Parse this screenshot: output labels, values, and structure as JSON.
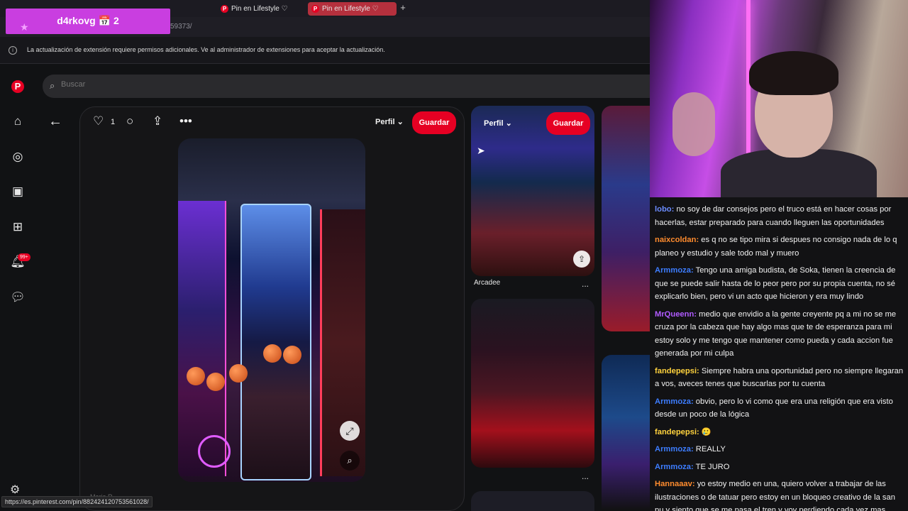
{
  "browser": {
    "tabs": [
      {
        "label": "Pin en Lifestyle ♡",
        "active": false
      },
      {
        "label": "Pin en Lifestyle ♡",
        "active": true
      }
    ],
    "new_tab": "+",
    "url_fragment": "59373/"
  },
  "overlay": {
    "badge_text": "d4rkovg 📅 2"
  },
  "notification": {
    "text": "La actualización de extensión requiere permisos adicionales. Ve al administrador de extensiones para aceptar la actualización."
  },
  "search": {
    "placeholder": "Buscar"
  },
  "nav": {
    "notifications_count": "99+"
  },
  "pin": {
    "like_count": "1",
    "profile_label": "Perfil",
    "save_label": "Guardar",
    "author": "Mario R."
  },
  "related": {
    "card1": {
      "profile_label": "Perfil",
      "save_label": "Guardar",
      "title": "Arcadee"
    },
    "more": "..."
  },
  "status_url": "https://es.pinterest.com/pin/882424120753561028/",
  "chat": [
    {
      "user": "lobo:",
      "color": "#6b8cff",
      "text": "no soy de dar consejos pero el truco está en hacer cosas por hacerlas, estar preparado para cuando lleguen las oportunidades"
    },
    {
      "user": "naixcoldan:",
      "color": "#ff8c2e",
      "text": "es q no se tipo mira si despues no consigo nada de lo q planeo y estudio y sale todo mal y muero"
    },
    {
      "user": "Armmoza:",
      "color": "#3d7dff",
      "text": "Tengo una amiga budista, de Soka, tienen la creencia de que se puede salir hasta de lo peor pero por su propia cuenta, no sé explicarlo bien, pero vi un acto que hicieron y era muy lindo"
    },
    {
      "user": "MrQueenn:",
      "color": "#b05bff",
      "text": "medio que envidio a la gente creyente pq a mi no se me cruza por la cabeza que hay algo mas que te de esperanza para mi estoy solo y me tengo que mantener como pueda y cada accion fue generada por mi culpa"
    },
    {
      "user": "fandepepsi:",
      "color": "#ffd23d",
      "text": "Siempre habra una oportunidad pero no siempre llegaran a vos, aveces tenes que buscarlas por tu cuenta"
    },
    {
      "user": "Armmoza:",
      "color": "#3d7dff",
      "text": "obvio, pero lo vi como que era una religión que era visto desde un poco de la lógica"
    },
    {
      "user": "fandepepsi:",
      "color": "#ffd23d",
      "text": "🥲"
    },
    {
      "user": "Armmoza:",
      "color": "#3d7dff",
      "text": "REALLY"
    },
    {
      "user": "Armmoza:",
      "color": "#3d7dff",
      "text": "TE JURO"
    },
    {
      "user": "Hannaaav:",
      "color": "#ff8c2e",
      "text": "yo estoy medio en una, quiero volver a trabajar de las ilustraciones o de tatuar pero estoy en un bloqueo creativo de la san pu y siento que se me pasa el tren y voy perdiendo cada vez mas oportunidades y asi"
    }
  ]
}
